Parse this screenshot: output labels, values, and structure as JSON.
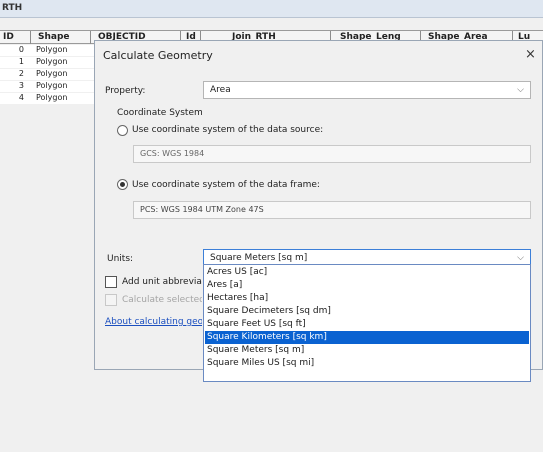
{
  "window": {
    "title": "RTH"
  },
  "attribute_table": {
    "headers": [
      "ID",
      "Shape",
      "OBJECTID",
      "Id",
      "Join_RTH",
      "Shape_Leng",
      "Shape_Area",
      "Lu"
    ],
    "rows": [
      {
        "id": "0",
        "shape": "Polygon"
      },
      {
        "id": "1",
        "shape": "Polygon"
      },
      {
        "id": "2",
        "shape": "Polygon"
      },
      {
        "id": "3",
        "shape": "Polygon"
      },
      {
        "id": "4",
        "shape": "Polygon"
      }
    ]
  },
  "dialog": {
    "title": "Calculate Geometry",
    "close": "×",
    "property_label": "Property:",
    "property_value": "Area",
    "coord_system_label": "Coordinate System",
    "radio_source_label": "Use coordinate system of the data source:",
    "radio_source_value": "GCS: WGS 1984",
    "radio_frame_label": "Use coordinate system of the data frame:",
    "radio_frame_value": "PCS: WGS 1984 UTM Zone 47S",
    "units_label": "Units:",
    "units_value": "Square Meters [sq m]",
    "add_unit_label": "Add unit abbreviation",
    "calc_selected_label": "Calculate selected records only",
    "about_link": "About calculating geometry",
    "units_options": [
      "Acres US [ac]",
      "Ares [a]",
      "Hectares [ha]",
      "Square Decimeters [sq dm]",
      "Square Feet US [sq ft]",
      "Square Kilometers [sq km]",
      "Square Meters [sq m]",
      "Square Miles US [sq mi]"
    ],
    "selected_option_index": 5
  }
}
